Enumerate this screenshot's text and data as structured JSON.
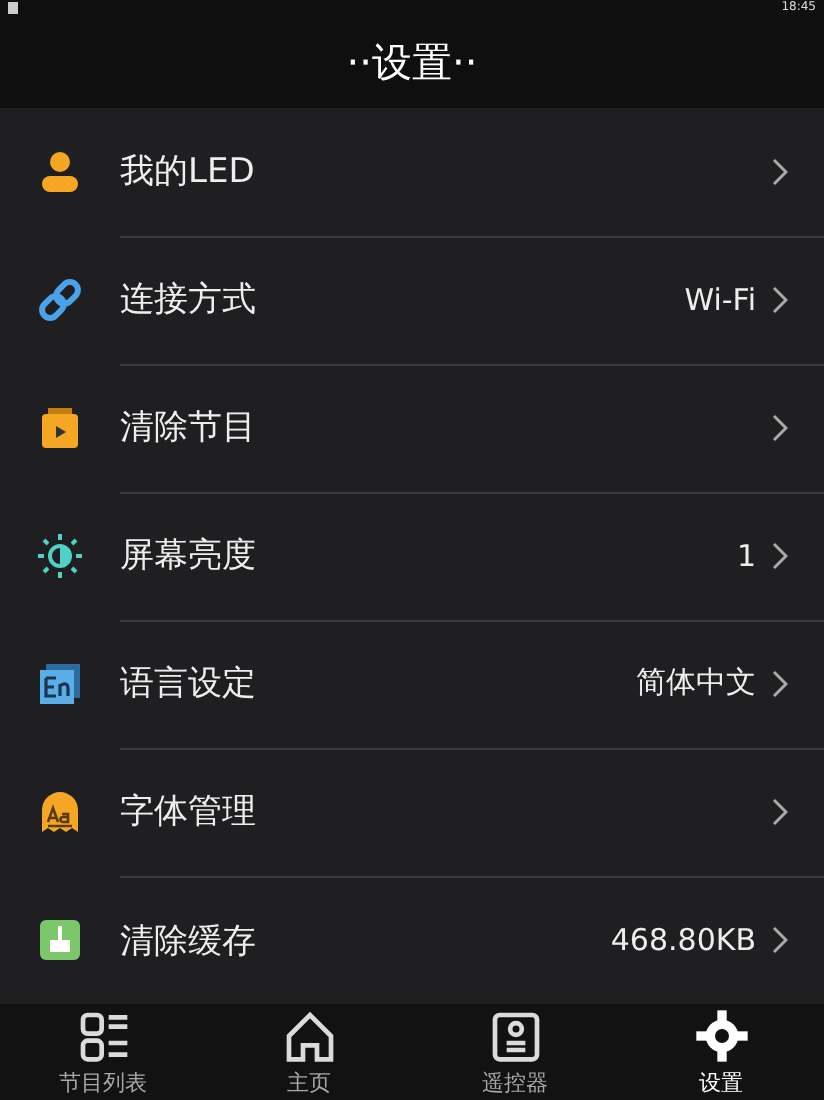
{
  "status_bar": {
    "time": "18:45"
  },
  "header": {
    "title": "··设置··"
  },
  "settings": [
    {
      "label": "我的LED"
    },
    {
      "label": "连接方式",
      "value": "Wi-Fi"
    },
    {
      "label": "清除节目"
    },
    {
      "label": "屏幕亮度",
      "value": "1"
    },
    {
      "label": "语言设定",
      "value": "简体中文"
    },
    {
      "label": "字体管理"
    },
    {
      "label": "清除缓存",
      "value": "468.80KB"
    }
  ],
  "tab_bar": [
    {
      "label": "节目列表",
      "selected": false
    },
    {
      "label": "主页",
      "selected": false
    },
    {
      "label": "遥控器",
      "selected": false
    },
    {
      "label": "设置",
      "selected": true
    }
  ]
}
